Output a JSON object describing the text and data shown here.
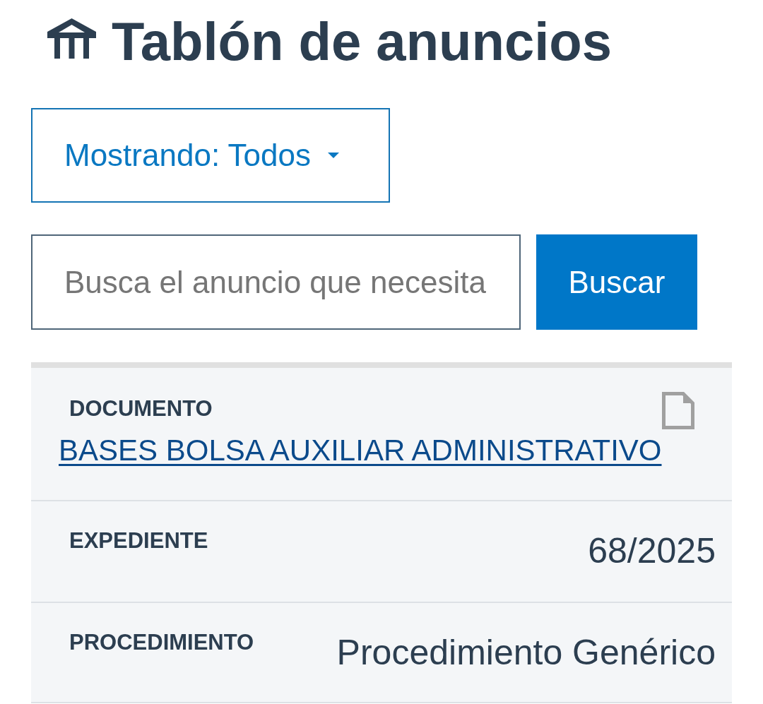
{
  "header": {
    "title": "Tablón de anuncios"
  },
  "filter": {
    "label": "Mostrando: Todos"
  },
  "search": {
    "placeholder": "Busca el anuncio que necesita",
    "button": "Buscar"
  },
  "details": [
    {
      "kind": "document",
      "label": "DOCUMENTO",
      "value": "BASES BOLSA AUXILIAR ADMINISTRATIVO"
    },
    {
      "kind": "text",
      "label": "EXPEDIENTE",
      "value": "68/2025"
    },
    {
      "kind": "text",
      "label": "PROCEDIMIENTO",
      "value": "Procedimiento Genérico"
    }
  ]
}
